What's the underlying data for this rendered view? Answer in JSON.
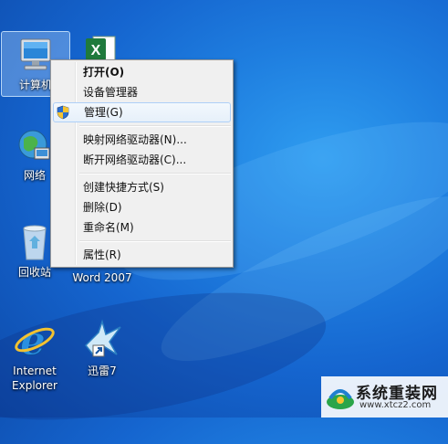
{
  "desktop": {
    "icons": [
      {
        "label": "计算机",
        "icon": "computer-icon"
      },
      {
        "label": "",
        "icon": "excel-icon"
      },
      {
        "label": "网络",
        "icon": "network-icon"
      },
      {
        "label": "回收站",
        "icon": "recycle-bin-icon"
      },
      {
        "label": "Word 2007",
        "icon": "word-icon"
      },
      {
        "label_line1": "Internet",
        "label_line2": "Explorer",
        "icon": "internet-explorer-icon"
      },
      {
        "label": "迅雷7",
        "icon": "xunlei-icon"
      }
    ]
  },
  "context_menu": {
    "items": [
      {
        "label": "打开(O)"
      },
      {
        "label": "设备管理器"
      },
      {
        "label": "管理(G)",
        "icon": "uac-shield-icon"
      },
      {
        "label": "映射网络驱动器(N)..."
      },
      {
        "label": "断开网络驱动器(C)..."
      },
      {
        "label": "创建快捷方式(S)"
      },
      {
        "label": "删除(D)"
      },
      {
        "label": "重命名(M)"
      },
      {
        "label": "属性(R)"
      }
    ]
  },
  "watermark": {
    "title": "系统重装网",
    "url": "www.xtcz2.com",
    "icon": "watermark-logo-icon"
  },
  "colors": {
    "desktop_blue": "#1f7fe0",
    "menu_bg": "#f0f0f0",
    "hover_border": "#aecff7"
  }
}
